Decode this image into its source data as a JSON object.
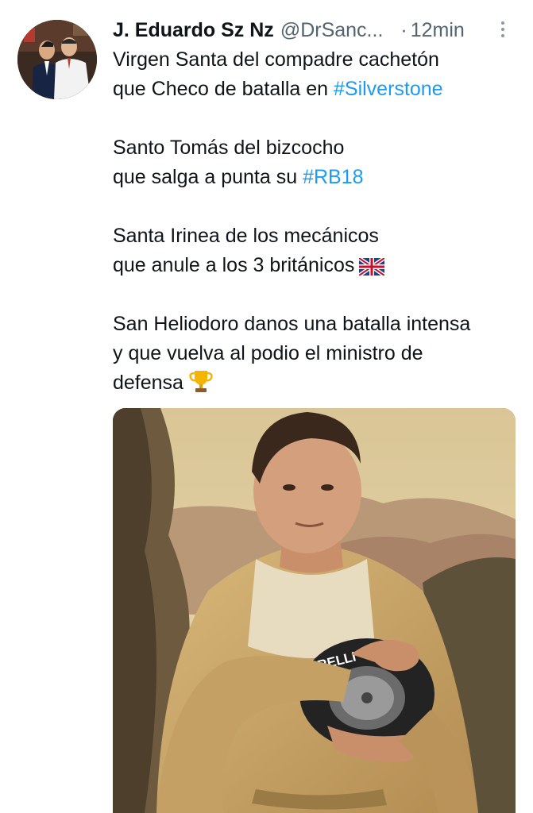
{
  "tweet": {
    "display_name": "J. Eduardo Sz Nz",
    "handle": "@DrSanc...",
    "separator": "·",
    "time": "12min",
    "lines": [
      {
        "text": "Virgen Santa del compadre cachetón"
      },
      {
        "text": "que Checo de batalla en ",
        "hashtag": "#Silverstone"
      },
      {
        "gap": true
      },
      {
        "text": "Santo Tomás del bizcocho"
      },
      {
        "text": "que salga a punta su ",
        "hashtag": "#RB18"
      },
      {
        "gap": true
      },
      {
        "text": "Santa Irinea de los mecánicos"
      },
      {
        "text": "que anule a los 3 británicos",
        "emoji": "uk-flag"
      },
      {
        "gap": true
      },
      {
        "text": "San Heliodoro danos una batalla intensa"
      },
      {
        "text": "y que vuelva al podio el ministro de"
      },
      {
        "text": "defensa",
        "emoji": "trophy"
      }
    ],
    "media": {
      "tire_brand": "IRELLI",
      "description_icon": "painting-image"
    }
  },
  "colors": {
    "text": "#0f1419",
    "secondary": "#536471",
    "link": "#1d9bf0"
  },
  "icons": {
    "more": "more-dots-icon",
    "uk_flag": "uk-flag-icon",
    "trophy": "trophy-icon"
  }
}
